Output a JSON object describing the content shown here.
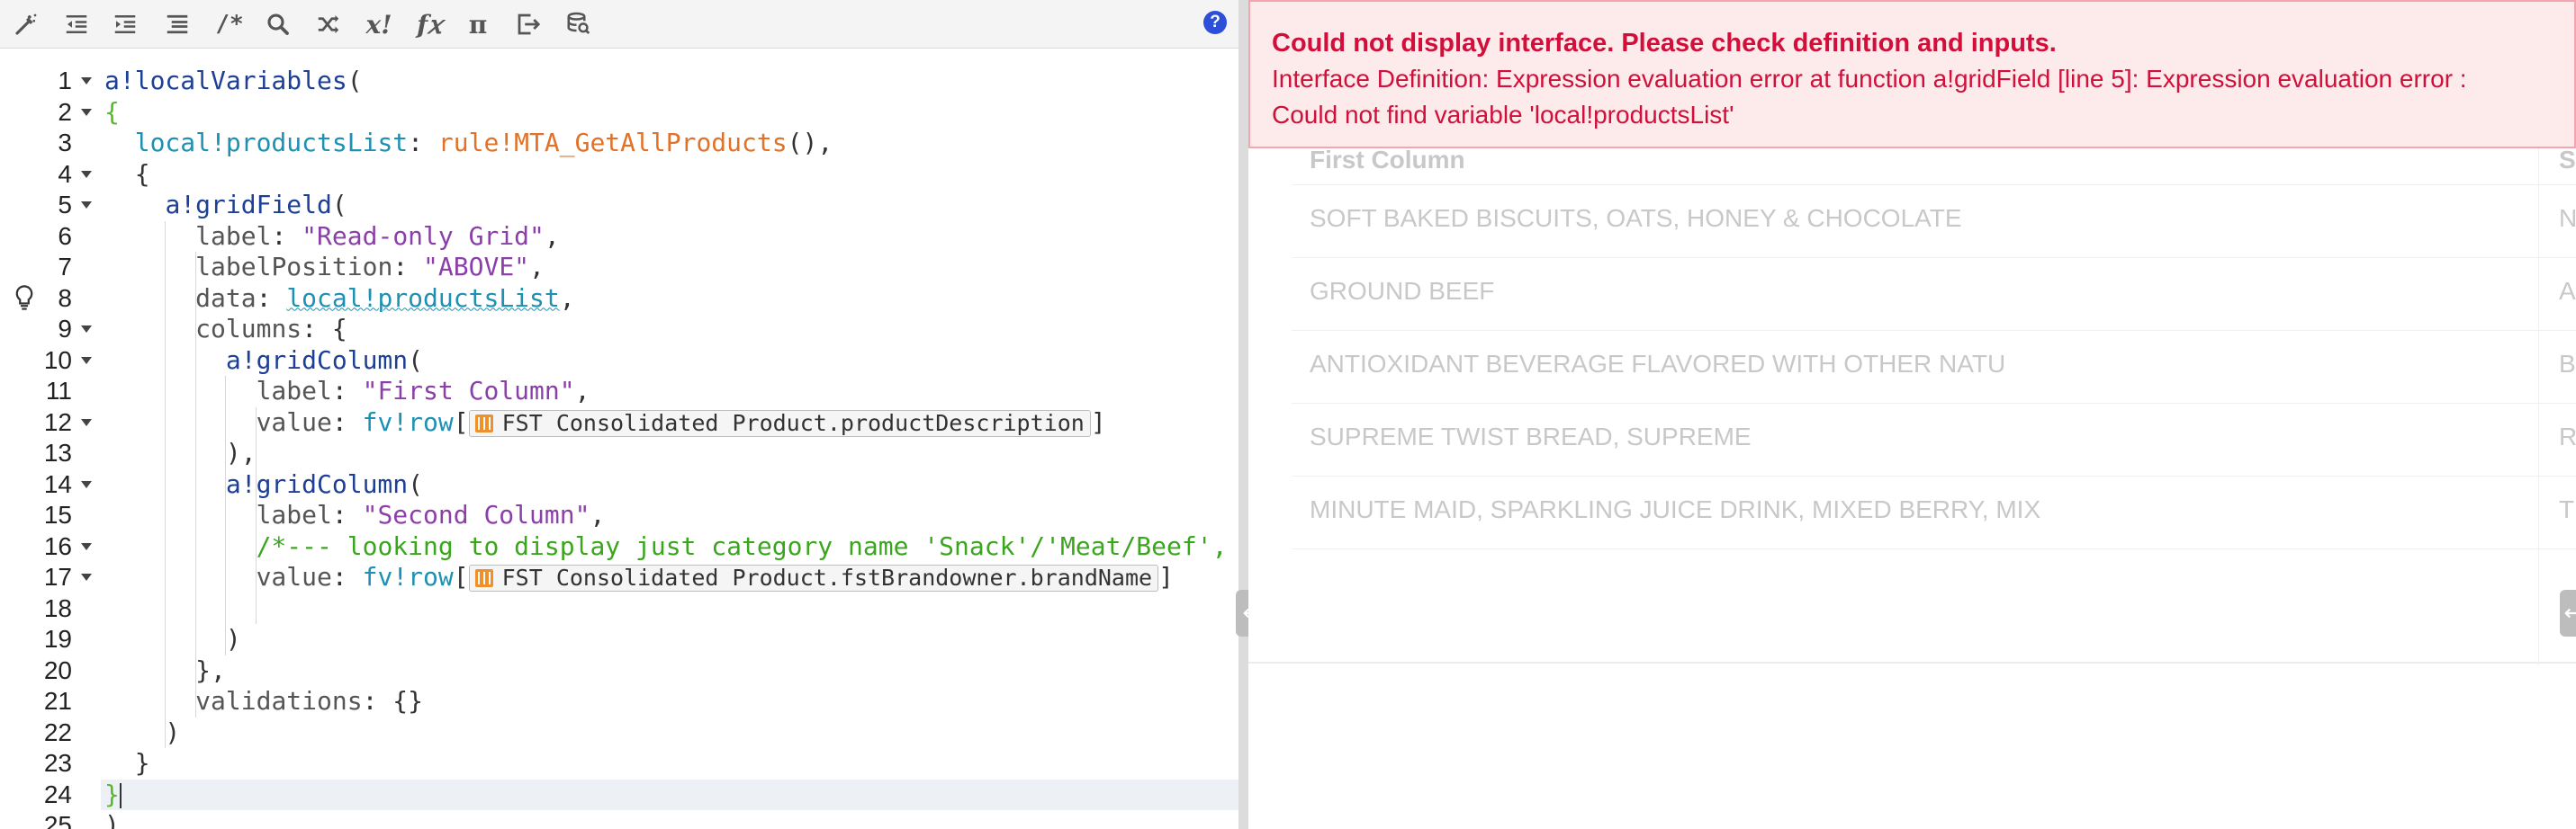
{
  "toolbar": {
    "icons": [
      "format-wand",
      "outdent",
      "indent",
      "reindent",
      "comment-toggle",
      "search",
      "shuffle",
      "eval",
      "function",
      "pi",
      "export",
      "query-database"
    ],
    "comment_label": "/*",
    "eval_label": "x!",
    "fx_label": "f𝑥",
    "pi_label": "π",
    "help_label": "?"
  },
  "editor": {
    "line_numbers": [
      "1",
      "2",
      "3",
      "4",
      "5",
      "6",
      "7",
      "8",
      "9",
      "10",
      "11",
      "12",
      "13",
      "14",
      "15",
      "16",
      "17",
      "18",
      "19",
      "20",
      "21",
      "22",
      "23",
      "24",
      "25"
    ],
    "fold_lines": [
      1,
      2,
      4,
      5,
      9,
      10,
      12,
      14,
      16,
      17
    ],
    "hint_line": 8,
    "active_line": 24,
    "lines": [
      {
        "n": 1,
        "tokens": [
          [
            "kw-fn",
            "a!localVariables"
          ],
          [
            "",
            "("
          ]
        ]
      },
      {
        "n": 2,
        "tokens": [
          [
            "brace-g",
            "{"
          ]
        ]
      },
      {
        "n": 3,
        "tokens": [
          [
            "",
            "  "
          ],
          [
            "kw-loc",
            "local!productsList"
          ],
          [
            "",
            ": "
          ],
          [
            "kw-rule",
            "rule!MTA_GetAllProducts"
          ],
          [
            "",
            "(),"
          ]
        ]
      },
      {
        "n": 4,
        "tokens": [
          [
            "",
            "  {"
          ]
        ]
      },
      {
        "n": 5,
        "tokens": [
          [
            "",
            "    "
          ],
          [
            "kw-fn",
            "a!gridField"
          ],
          [
            "",
            "("
          ]
        ]
      },
      {
        "n": 6,
        "tokens": [
          [
            "",
            "      "
          ],
          [
            "prop",
            "label"
          ],
          [
            "",
            ": "
          ],
          [
            "str",
            "\"Read-only Grid\""
          ],
          [
            "",
            ","
          ]
        ]
      },
      {
        "n": 7,
        "tokens": [
          [
            "",
            "      "
          ],
          [
            "prop",
            "labelPosition"
          ],
          [
            "",
            ": "
          ],
          [
            "str",
            "\"ABOVE\""
          ],
          [
            "",
            ","
          ]
        ]
      },
      {
        "n": 8,
        "tokens": [
          [
            "",
            "      "
          ],
          [
            "prop",
            "data"
          ],
          [
            "",
            ": "
          ],
          [
            "kw-loc squig",
            "local!productsList"
          ],
          [
            "",
            ","
          ]
        ]
      },
      {
        "n": 9,
        "tokens": [
          [
            "",
            "      "
          ],
          [
            "prop",
            "columns"
          ],
          [
            "",
            ": {"
          ]
        ]
      },
      {
        "n": 10,
        "tokens": [
          [
            "",
            "        "
          ],
          [
            "kw-fn",
            "a!gridColumn"
          ],
          [
            "",
            "("
          ]
        ]
      },
      {
        "n": 11,
        "tokens": [
          [
            "",
            "          "
          ],
          [
            "prop",
            "label"
          ],
          [
            "",
            ": "
          ],
          [
            "str",
            "\"First Column\""
          ],
          [
            "",
            ","
          ]
        ]
      },
      {
        "n": 12,
        "tokens": [
          [
            "",
            "          "
          ],
          [
            "prop",
            "value"
          ],
          [
            "",
            ": "
          ],
          [
            "kw-fv",
            "fv!row"
          ],
          [
            "",
            "["
          ],
          [
            "rec",
            "FST Consolidated Product.productDescription"
          ],
          [
            "",
            "]"
          ]
        ]
      },
      {
        "n": 13,
        "tokens": [
          [
            "",
            "        ),"
          ]
        ]
      },
      {
        "n": 14,
        "tokens": [
          [
            "",
            "        "
          ],
          [
            "kw-fn",
            "a!gridColumn"
          ],
          [
            "",
            "("
          ]
        ]
      },
      {
        "n": 15,
        "tokens": [
          [
            "",
            "          "
          ],
          [
            "prop",
            "label"
          ],
          [
            "",
            ": "
          ],
          [
            "str",
            "\"Second Column\""
          ],
          [
            "",
            ","
          ]
        ]
      },
      {
        "n": 16,
        "tokens": [
          [
            "",
            "          "
          ],
          [
            "cmt",
            "/*--- looking to display just category name 'Snack'/'Meat/Beef',"
          ]
        ]
      },
      {
        "n": 17,
        "tokens": [
          [
            "",
            "          "
          ],
          [
            "prop",
            "value"
          ],
          [
            "",
            ": "
          ],
          [
            "kw-fv",
            "fv!row"
          ],
          [
            "",
            "["
          ],
          [
            "rec",
            "FST Consolidated Product.fstBrandowner.brandName"
          ],
          [
            "",
            "]"
          ]
        ]
      },
      {
        "n": 18,
        "tokens": [
          [
            "",
            ""
          ]
        ]
      },
      {
        "n": 19,
        "tokens": [
          [
            "",
            "        )"
          ]
        ]
      },
      {
        "n": 20,
        "tokens": [
          [
            "",
            "      },"
          ]
        ]
      },
      {
        "n": 21,
        "tokens": [
          [
            "",
            "      "
          ],
          [
            "prop",
            "validations"
          ],
          [
            "",
            ": {}"
          ]
        ]
      },
      {
        "n": 22,
        "tokens": [
          [
            "",
            "    )"
          ]
        ]
      },
      {
        "n": 23,
        "tokens": [
          [
            "",
            "  }"
          ]
        ]
      },
      {
        "n": 24,
        "tokens": [
          [
            "brace-g",
            "}"
          ],
          [
            "cursor",
            ""
          ]
        ]
      },
      {
        "n": 25,
        "tokens": [
          [
            "",
            ")"
          ]
        ]
      }
    ]
  },
  "preview": {
    "error_title": "Could not display interface. Please check definition and inputs.",
    "error_message_1": "Interface Definition: Expression evaluation error at function a!gridField [line 5]: Expression evaluation error :",
    "error_message_2": "Could not find variable 'local!productsList'",
    "grid": {
      "columns": [
        "First Column",
        "S"
      ],
      "rows": [
        [
          "SOFT BAKED BISCUITS, OATS, HONEY & CHOCOLATE",
          "N"
        ],
        [
          "GROUND BEEF",
          "A"
        ],
        [
          "ANTIOXIDANT BEVERAGE FLAVORED WITH OTHER NATU",
          "B"
        ],
        [
          "SUPREME TWIST BREAD, SUPREME",
          "R"
        ],
        [
          "MINUTE MAID, SPARKLING JUICE DRINK, MIXED BERRY, MIX",
          "T"
        ]
      ]
    }
  },
  "colors": {
    "error_text": "#d0103a",
    "error_bg": "#fdeaeb",
    "function": "#1d3f96",
    "local": "#1e90b3",
    "rule": "#e0722a",
    "string": "#8b3fa8",
    "comment": "#3aa61e"
  }
}
